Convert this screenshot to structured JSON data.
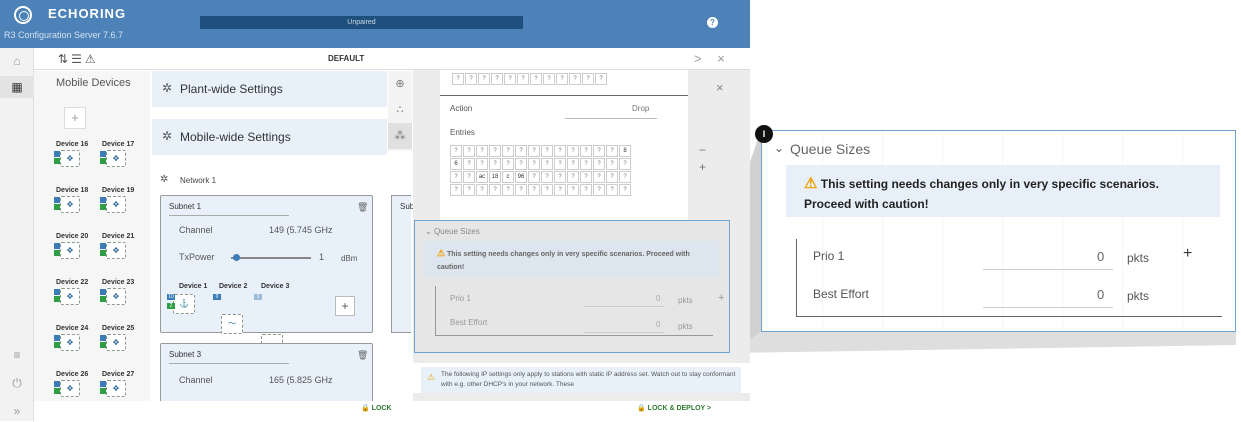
{
  "app": {
    "title": "ECHORING",
    "subtitle": "R3 Configuration Server 7.6.7",
    "status": "Unpaired",
    "help": "?"
  },
  "toolbar": {
    "center": "DEFAULT",
    "right": "> ×"
  },
  "devices_panel": {
    "title": "Mobile Devices",
    "add": "+",
    "rows": [
      [
        "Device 16",
        "Device 17"
      ],
      [
        "Device 18",
        "Device 19"
      ],
      [
        "Device 20",
        "Device 21"
      ],
      [
        "Device 22",
        "Device 23"
      ],
      [
        "Device 24",
        "Device 25"
      ],
      [
        "Device 26",
        "Device 27"
      ]
    ]
  },
  "cards": {
    "plant": "Plant-wide Settings",
    "mobile": "Mobile-wide Settings"
  },
  "network": {
    "name": "Network 1",
    "subnet1": {
      "title": "Subnet 1",
      "channel_label": "Channel",
      "channel_value": "149 (5.745 GHz",
      "txpower_label": "TxPower",
      "txpower_value": "1",
      "txpower_unit": "dBm",
      "devices": [
        "Device 1",
        "Device 2",
        "Device 3"
      ],
      "add": "+",
      "tags": [
        "10",
        "0",
        "1"
      ],
      "tag2": "2"
    },
    "subnet2": {
      "title": "Sub"
    },
    "subnet3": {
      "title": "Subnet 3",
      "channel_label": "Channel",
      "channel_value": "165 (5.825 GHz"
    }
  },
  "dialog": {
    "grid_top": [
      "?",
      "?",
      "?",
      "?",
      "?",
      "?",
      "?",
      "?",
      "?",
      "?",
      "?",
      "?"
    ],
    "action_label": "Action",
    "action_value": "Drop",
    "entries_label": "Entries",
    "entries": [
      [
        "?",
        "?",
        "?",
        "?",
        "?",
        "?",
        "?",
        "?",
        "?",
        "?",
        "?",
        "?",
        "?",
        "8"
      ],
      [
        "6",
        "?",
        "?",
        "?",
        "?",
        "?",
        "?",
        "?",
        "?",
        "?",
        "?",
        "?",
        "?",
        "?"
      ],
      [
        "?",
        "?",
        "ac",
        "18",
        "c",
        "96",
        "?",
        "?",
        "?",
        "?",
        "?",
        "?",
        "?",
        "?"
      ],
      [
        "?",
        "?",
        "?",
        "?",
        "?",
        "?",
        "?",
        "?",
        "?",
        "?",
        "?",
        "?",
        "?",
        "?"
      ]
    ],
    "close": "×",
    "minus": "−",
    "plus": "+"
  },
  "queue_sizes": {
    "title": "Queue Sizes",
    "warning": "This setting needs changes only in very specific scenarios. Proceed with caution!",
    "warning_line1": "This setting needs changes only in very specific scenarios.",
    "warning_line2": "Proceed with caution!",
    "rows": [
      {
        "label": "Prio 1",
        "value": "0",
        "unit": "pkts"
      },
      {
        "label": "Best Effort",
        "value": "0",
        "unit": "pkts"
      }
    ],
    "add": "+"
  },
  "ip_info": {
    "text": "The following IP settings only apply to stations with static IP address set. Watch out to stay conformant with e.g. other DHCP's in your network. These"
  },
  "footer": {
    "lock": "LOCK",
    "deploy": "LOCK & DEPLOY >"
  },
  "callout": {
    "badge": "I"
  },
  "colors": {
    "header": "#4d82b8",
    "accent": "#2e7d32",
    "warning": "#f0a000",
    "card": "#e8f1fa"
  }
}
